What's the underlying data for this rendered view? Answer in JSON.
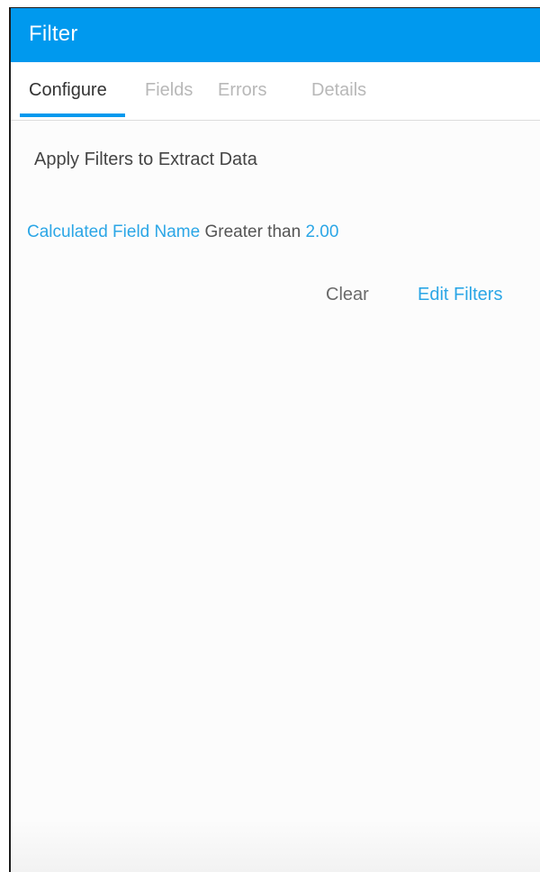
{
  "header": {
    "title": "Filter"
  },
  "tabs": [
    {
      "label": "Configure",
      "active": true
    },
    {
      "label": "Fields",
      "active": false
    },
    {
      "label": "Errors",
      "active": false
    },
    {
      "label": "Details",
      "active": false
    }
  ],
  "main": {
    "section_title": "Apply Filters to Extract Data",
    "filter": {
      "field": "Calculated Field Name",
      "operator": "Greater than",
      "value": "2.00"
    },
    "actions": {
      "clear_label": "Clear",
      "edit_label": "Edit Filters"
    }
  },
  "colors": {
    "header_background": "#0099ee",
    "accent_link": "#2ba6e6",
    "active_tab_underline": "#0099ee"
  }
}
